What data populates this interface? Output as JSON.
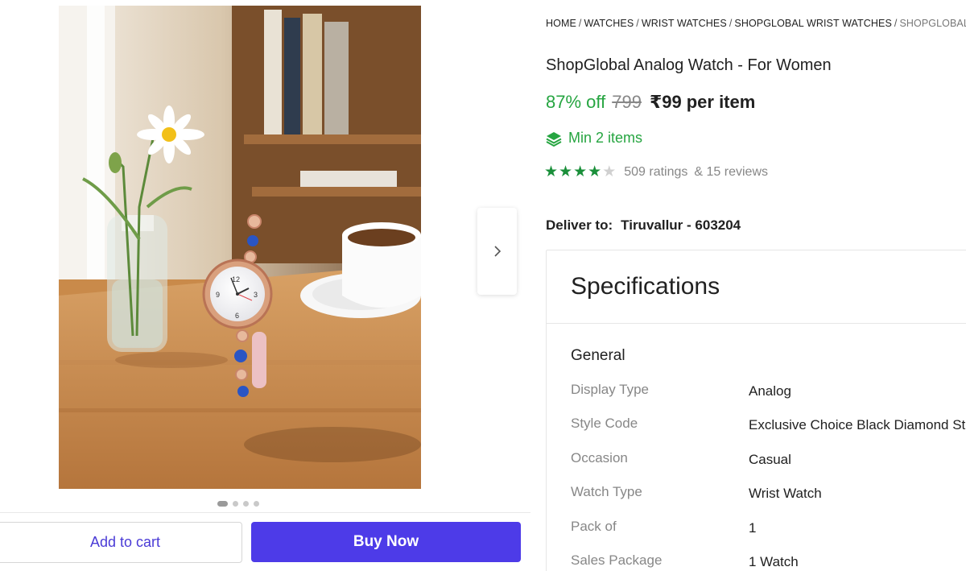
{
  "breadcrumb": [
    {
      "label": "HOME"
    },
    {
      "label": "WATCHES"
    },
    {
      "label": "WRIST WATCHES"
    },
    {
      "label": "SHOPGLOBAL WRIST WATCHES"
    },
    {
      "label": "SHOPGLOBAL"
    }
  ],
  "product": {
    "title": "ShopGlobal Analog Watch  - For Women",
    "discount": "87% off",
    "mrp": "799",
    "price": "₹99",
    "per_item": "per item",
    "min_items": "Min 2 items",
    "rating_stars": 4,
    "ratings_text": "509 ratings",
    "reviews_text": "& 15 reviews"
  },
  "delivery": {
    "label": "Deliver to:",
    "location": "Tiruvallur - 603204"
  },
  "gallery": {
    "total_images": 4,
    "active_index": 0
  },
  "actions": {
    "add_to_cart": "Add to cart",
    "buy_now": "Buy Now"
  },
  "specifications": {
    "title": "Specifications",
    "group": "General",
    "rows": [
      {
        "key": "Display Type",
        "value": "Analog"
      },
      {
        "key": "Style Code",
        "value": "Exclusive Choice Black Diamond Stu"
      },
      {
        "key": "Occasion",
        "value": "Casual"
      },
      {
        "key": "Watch Type",
        "value": "Wrist Watch"
      },
      {
        "key": "Pack of",
        "value": "1"
      },
      {
        "key": "Sales Package",
        "value": "1 Watch"
      }
    ]
  },
  "colors": {
    "accent": "#4d3be8",
    "discount_green": "#26a541",
    "star_green": "#1a8f3a"
  },
  "icons": {
    "min_items": "layers-icon",
    "next": "chevron-right-icon"
  }
}
